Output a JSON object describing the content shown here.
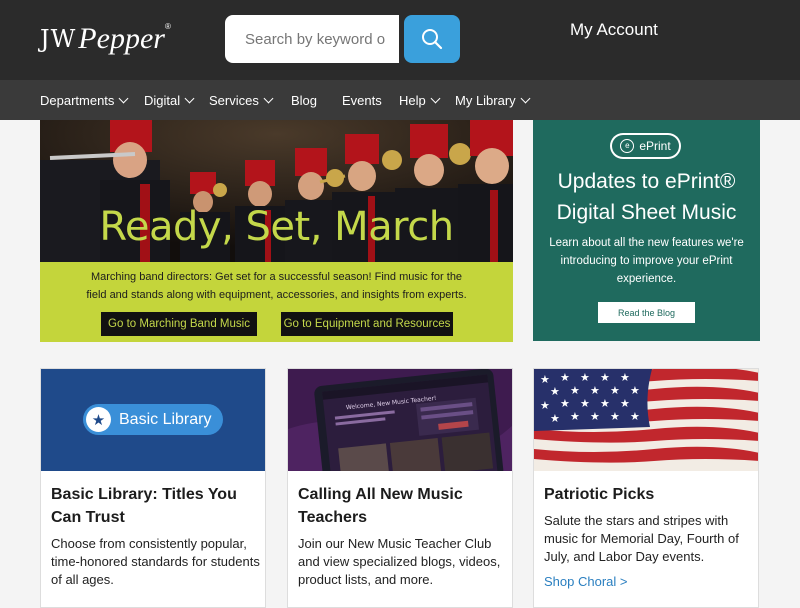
{
  "header": {
    "logo": {
      "text_jw": "JW",
      "text_pepper": "Pepper",
      "reg": "®"
    },
    "search": {
      "placeholder": "Search by keyword or item #",
      "button_icon": "search-icon"
    },
    "account_label": "My Account"
  },
  "nav": {
    "items": [
      {
        "label": "Departments",
        "dropdown": true
      },
      {
        "label": "Digital",
        "dropdown": true
      },
      {
        "label": "Services",
        "dropdown": true
      },
      {
        "label": "Blog",
        "dropdown": false
      },
      {
        "label": "Events",
        "dropdown": false
      },
      {
        "label": "Help",
        "dropdown": true
      },
      {
        "label": "My Library",
        "dropdown": true
      }
    ]
  },
  "hero": {
    "title": "Ready, Set, March",
    "text": "Marching band directors: Get set for a successful season! Find music for the field and stands along with equipment, accessories, and insights from experts.",
    "buttons": [
      "Go to Marching Band Music",
      "Go to Equipment and Resources"
    ],
    "title_color": "#c4d84a",
    "band_color": "#c4d53b"
  },
  "eprint": {
    "badge": "ePrint",
    "title_line1": "Updates to ePrint®",
    "title_line2": "Digital Sheet Music",
    "body": "Learn about all the new features we're introducing to improve your ePrint experience.",
    "button": "Read the Blog",
    "bg_color": "#1f6a5e"
  },
  "cards": [
    {
      "pill_label": "Basic Library",
      "title": "Basic Library: Titles You Can Trust",
      "body": "Choose from consistently popular, time-honored standards for students of all ages.",
      "link": ""
    },
    {
      "screen_heading": "Welcome, New Music Teacher!",
      "title": "Calling All New Music Teachers",
      "body": "Join our New Music Teacher Club and view specialized blogs, videos, product lists, and more.",
      "link": ""
    },
    {
      "title": "Patriotic Picks",
      "body": "Salute the stars and stripes with music for Memorial Day, Fourth of July, and Labor Day events.",
      "link": "Shop Choral  >"
    }
  ]
}
